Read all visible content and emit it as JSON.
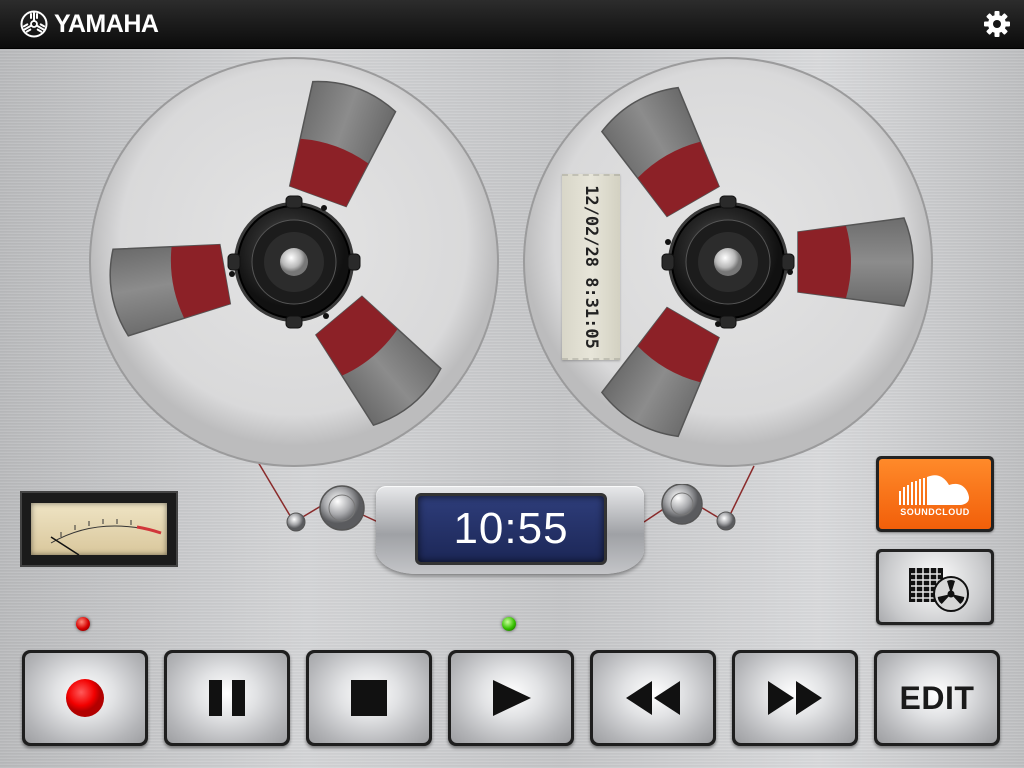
{
  "app": {
    "brand": "YAMAHA",
    "settings_icon": "gear-icon"
  },
  "tape": {
    "label_text": "12/02/28 8:31:05",
    "counter": "10:55"
  },
  "side_buttons": {
    "soundcloud_label": "SOUNDCLOUD",
    "soundcloud_icon": "soundcloud-cloud-icon",
    "library_icon": "tape-library-icon"
  },
  "transport": {
    "record_icon": "record-icon",
    "pause_icon": "pause-icon",
    "stop_icon": "stop-icon",
    "play_icon": "play-icon",
    "rewind_icon": "rewind-icon",
    "fast_forward_icon": "fast-forward-icon",
    "edit_label": "EDIT"
  },
  "indicators": {
    "record_led": "#e00000",
    "play_led": "#3fc400"
  },
  "colors": {
    "topbar": "#111111",
    "counter_bg": "#24316b",
    "soundcloud_orange": "#f2660f",
    "reel_spoke_red": "#8c2127"
  }
}
